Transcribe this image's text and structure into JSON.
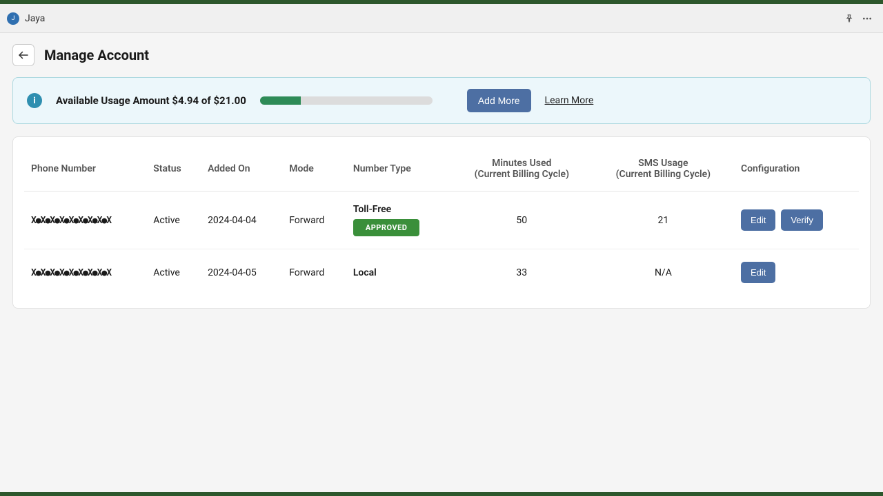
{
  "appbar": {
    "avatar_text": "Jaya",
    "title": "Jaya"
  },
  "page": {
    "title": "Manage Account"
  },
  "usage": {
    "label_prefix": "Available Usage Amount ",
    "amount_used": "$4.94",
    "of_word": " of ",
    "amount_total": "$21.00",
    "progress_pct": 23.5,
    "add_more_label": "Add More",
    "learn_more_label": "Learn More"
  },
  "table": {
    "headers": {
      "phone": "Phone Number",
      "status": "Status",
      "added": "Added On",
      "mode": "Mode",
      "numtype": "Number Type",
      "minutes": "Minutes Used\n(Current Billing Cycle)",
      "sms": "SMS Usage\n(Current Billing Cycle)",
      "config": "Configuration"
    },
    "rows": [
      {
        "phone_mask": "X●X●X●X●X●X●X●X●X",
        "status": "Active",
        "added": "2024-04-04",
        "mode": "Forward",
        "numtype_label": "Toll-Free",
        "numtype_badge": "APPROVED",
        "minutes": "50",
        "sms": "21",
        "buttons": [
          "Edit",
          "Verify"
        ]
      },
      {
        "phone_mask": "X●X●X●X●X●X●X●X●X",
        "status": "Active",
        "added": "2024-04-05",
        "mode": "Forward",
        "numtype_label": "Local",
        "numtype_badge": null,
        "minutes": "33",
        "sms": "N/A",
        "buttons": [
          "Edit"
        ]
      }
    ]
  }
}
